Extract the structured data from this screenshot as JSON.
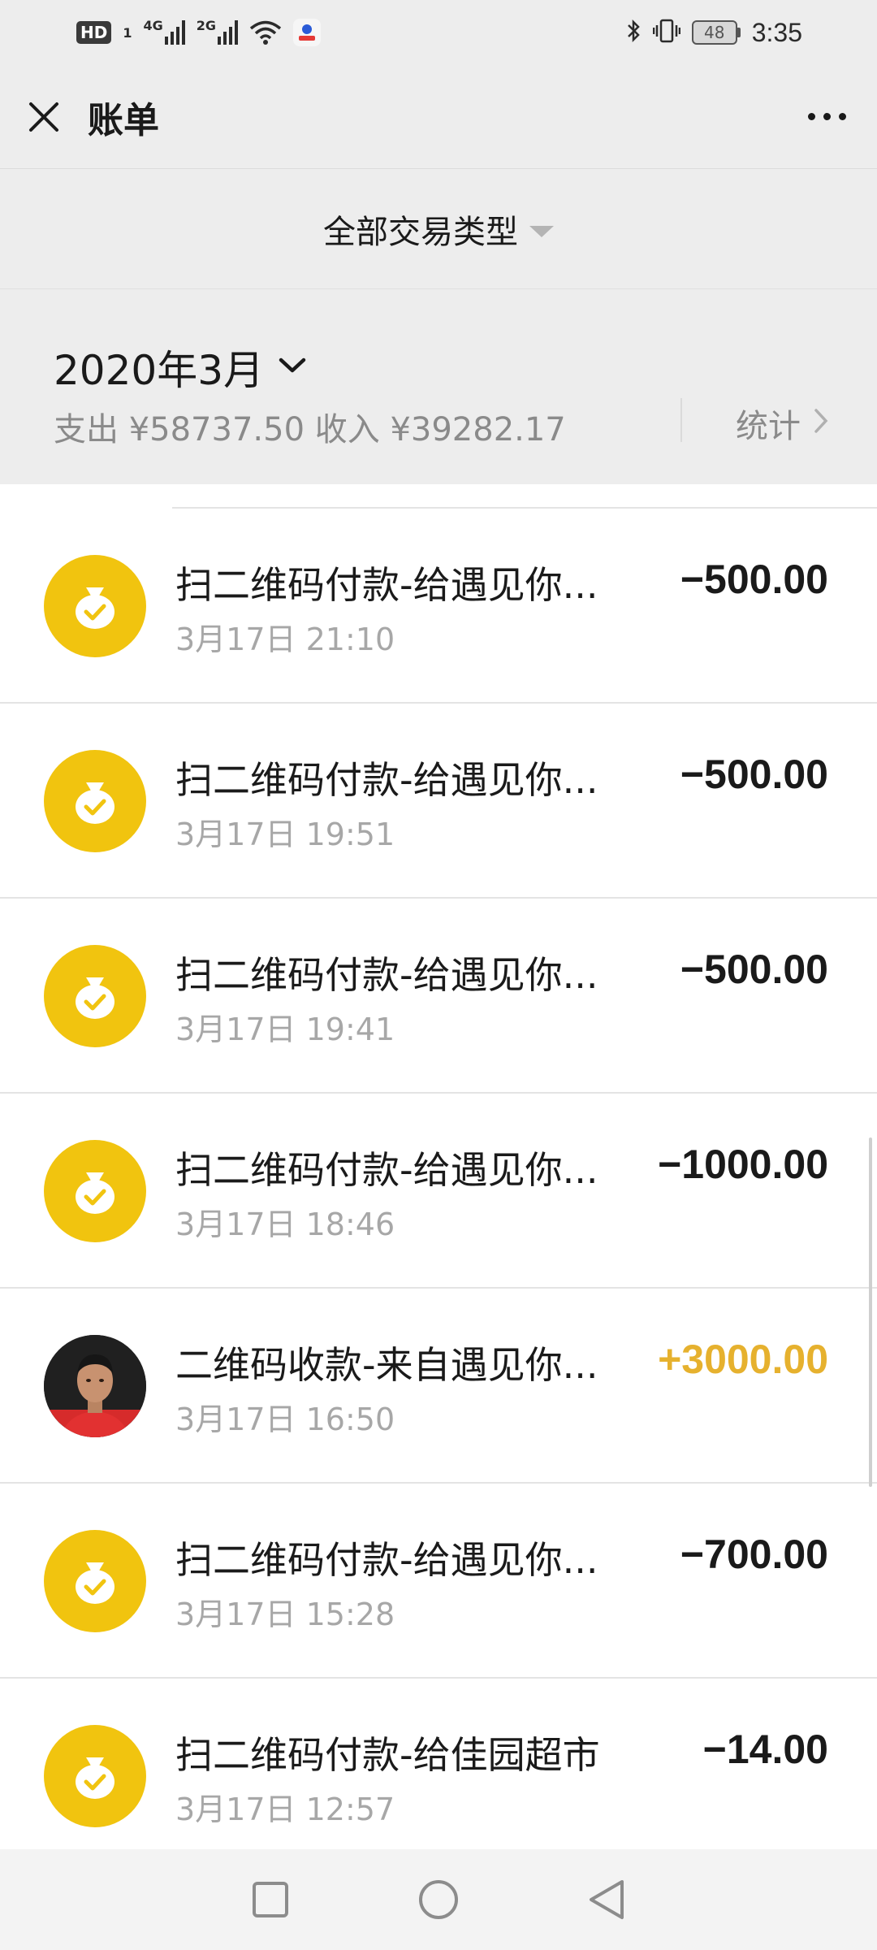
{
  "status_bar": {
    "hd": "HD",
    "sim1": "1",
    "net1": "4G",
    "net2": "2G",
    "battery": "48",
    "time": "3:35"
  },
  "header": {
    "title": "账单",
    "close_icon": "close-icon",
    "more_icon": "more-icon"
  },
  "filter": {
    "label": "全部交易类型"
  },
  "summary": {
    "month": "2020年3月",
    "totals": "支出 ¥58737.50 收入 ¥39282.17",
    "stats_label": "统计"
  },
  "transactions": [
    {
      "title": "扫二维码付款-给遇见你...",
      "date": "3月17日 21:10",
      "amount": "−500.00",
      "type": "expense",
      "icon": "money-bag-icon"
    },
    {
      "title": "扫二维码付款-给遇见你...",
      "date": "3月17日 19:51",
      "amount": "−500.00",
      "type": "expense",
      "icon": "money-bag-icon"
    },
    {
      "title": "扫二维码付款-给遇见你...",
      "date": "3月17日 19:41",
      "amount": "−500.00",
      "type": "expense",
      "icon": "money-bag-icon"
    },
    {
      "title": "扫二维码付款-给遇见你...",
      "date": "3月17日 18:46",
      "amount": "−1000.00",
      "type": "expense",
      "icon": "money-bag-icon"
    },
    {
      "title": "二维码收款-来自遇见你...",
      "date": "3月17日 16:50",
      "amount": "+3000.00",
      "type": "income",
      "icon": "avatar"
    },
    {
      "title": "扫二维码付款-给遇见你...",
      "date": "3月17日 15:28",
      "amount": "−700.00",
      "type": "expense",
      "icon": "money-bag-icon"
    },
    {
      "title": "扫二维码付款-给佳园超市",
      "date": "3月17日 12:57",
      "amount": "−14.00",
      "type": "expense",
      "icon": "money-bag-icon"
    }
  ],
  "colors": {
    "accent_yellow": "#f1c40f",
    "income_amount": "#e6b12e",
    "background": "#ededed"
  }
}
